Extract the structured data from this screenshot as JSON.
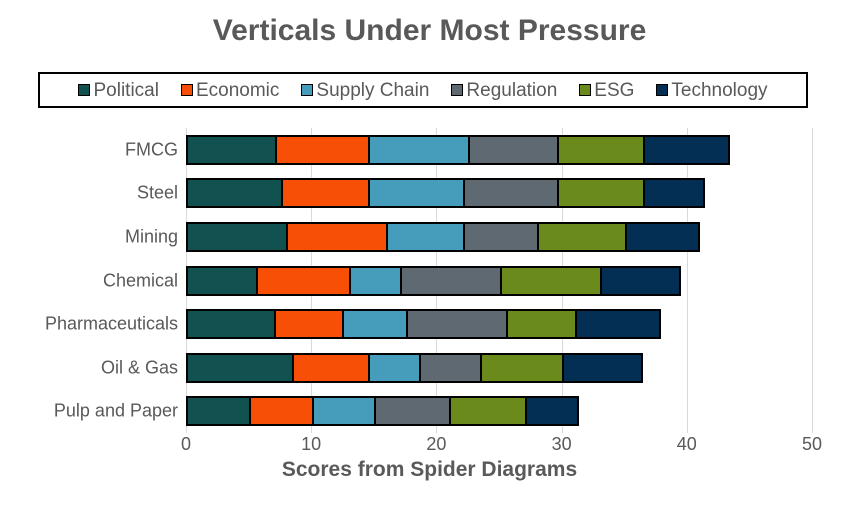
{
  "chart_data": {
    "type": "bar",
    "subtype": "stacked-horizontal-bar",
    "title": "Verticals Under Most Pressure",
    "xlabel": "Scores from Spider Diagrams",
    "ylabel": "",
    "xlim": [
      0,
      50
    ],
    "xticks": [
      0,
      10,
      20,
      30,
      40,
      50
    ],
    "grid": "vertical",
    "legend_position": "top",
    "categories": [
      "FMCG",
      "Steel",
      "Mining",
      "Chemical",
      "Pharmaceuticals",
      "Oil & Gas",
      "Pulp and Paper"
    ],
    "series": [
      {
        "name": "Political",
        "color": "#11514f",
        "values": [
          7.1,
          7.6,
          8.0,
          5.6,
          7.0,
          8.5,
          5.0
        ]
      },
      {
        "name": "Economic",
        "color": "#f74f06",
        "values": [
          7.4,
          6.9,
          8.0,
          7.4,
          5.5,
          6.0,
          5.1
        ]
      },
      {
        "name": "Supply Chain",
        "color": "#459dbb",
        "values": [
          8.0,
          7.6,
          6.1,
          4.1,
          5.1,
          4.1,
          4.9
        ]
      },
      {
        "name": "Regulation",
        "color": "#5f6971",
        "values": [
          7.1,
          7.5,
          5.9,
          8.0,
          8.0,
          4.9,
          6.0
        ]
      },
      {
        "name": "ESG",
        "color": "#6a8b1b",
        "values": [
          6.9,
          6.9,
          7.1,
          8.0,
          5.5,
          6.5,
          6.1
        ]
      },
      {
        "name": "Technology",
        "color": "#042f54",
        "values": [
          6.6,
          4.6,
          5.6,
          6.1,
          6.5,
          6.2,
          4.0
        ]
      }
    ],
    "totals": [
      43.1,
      41.1,
      40.7,
      39.2,
      37.6,
      36.2,
      31.1
    ]
  },
  "legend": {
    "items": [
      {
        "label": "Political",
        "color": "#11514f"
      },
      {
        "label": "Economic",
        "color": "#f74f06"
      },
      {
        "label": "Supply Chain",
        "color": "#459dbb"
      },
      {
        "label": "Regulation",
        "color": "#5f6971"
      },
      {
        "label": "ESG",
        "color": "#6a8b1b"
      },
      {
        "label": "Technology",
        "color": "#042f54"
      }
    ]
  },
  "colors": {
    "title_text": "#595959",
    "axis_text": "#595959",
    "gridline": "#d9d9d9",
    "bar_outline": "#000000",
    "background": "#ffffff"
  }
}
